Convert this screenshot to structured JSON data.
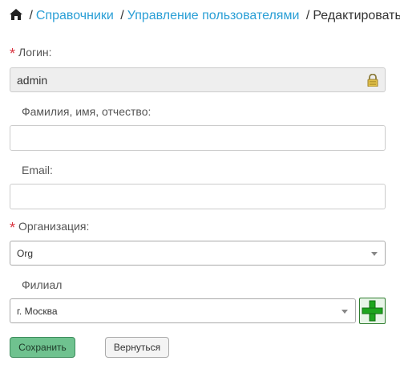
{
  "breadcrumb": {
    "items": [
      "Справочники",
      "Управление пользователями"
    ],
    "current": "Редактировать д",
    "separator": "/"
  },
  "form": {
    "login": {
      "label": "Логин:",
      "value": "admin",
      "required": true,
      "readonly": true
    },
    "fullname": {
      "label": "Фамилия, имя, отчество:",
      "value": ""
    },
    "email": {
      "label": "Email:",
      "value": ""
    },
    "organization": {
      "label": "Организация:",
      "selected": "Org",
      "required": true
    },
    "branch": {
      "label": "Филиал",
      "selected": "г. Москва"
    },
    "required_mark": "*"
  },
  "buttons": {
    "save": "Сохранить",
    "back": "Вернуться"
  },
  "colors": {
    "link": "#2a9fd6",
    "required": "#d9333f",
    "save_bg": "#6fc28f",
    "add_plus": "#1ea51e"
  }
}
